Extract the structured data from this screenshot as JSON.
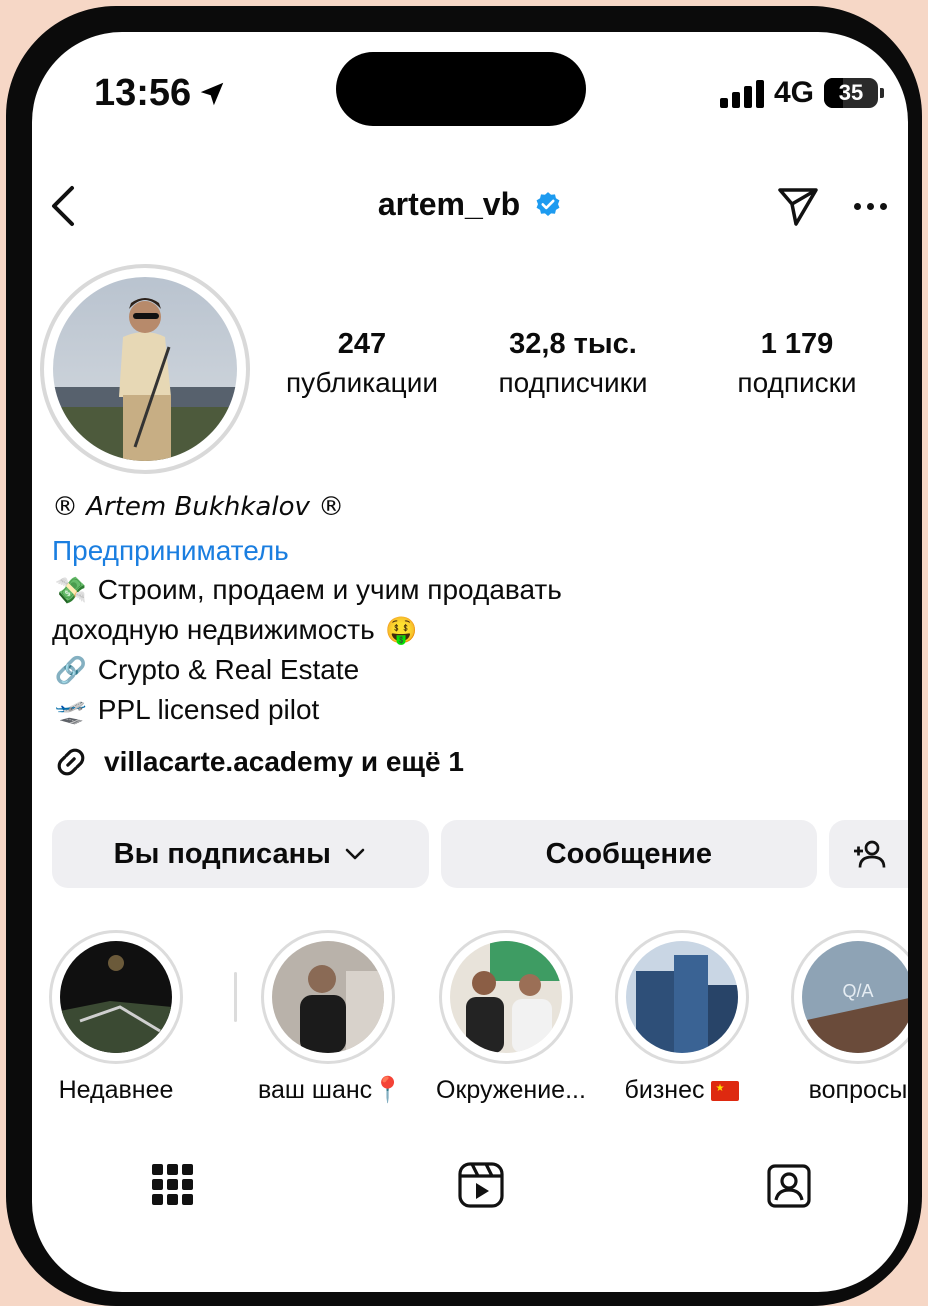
{
  "status_bar": {
    "time": "13:56",
    "network": "4G",
    "battery": "35"
  },
  "header": {
    "username": "artem_vb"
  },
  "stats": [
    {
      "number": "247",
      "label": "публикации"
    },
    {
      "number": "32,8 тыс.",
      "label": "подписчики"
    },
    {
      "number": "1 179",
      "label": "подписки"
    }
  ],
  "bio": {
    "name": "® Artem Bukhkalov ®",
    "category": "Предприниматель",
    "line1": "Строим, продаем и учим продавать",
    "line2": "доходную недвижимость",
    "line3": "Crypto & Real Estate",
    "line4": "PPL licensed pilot",
    "link": "villacarte.academy и ещё 1"
  },
  "actions": {
    "following": "Вы подписаны",
    "message": "Сообщение"
  },
  "highlights": [
    {
      "label": "Недавнее"
    },
    {
      "label": "ваш шанс"
    },
    {
      "label": "Окружение..."
    },
    {
      "label": "бизнес"
    },
    {
      "label": "вопросы"
    }
  ],
  "icons": {
    "location_arrow": "location-arrow-icon",
    "back": "chevron-left-icon",
    "verified": "verified-badge-icon",
    "send": "paper-plane-icon",
    "more": "more-dots-icon",
    "link": "link-icon",
    "add_person": "add-person-icon",
    "grid": "grid-icon",
    "reels": "reels-icon",
    "tagged": "tagged-person-icon"
  },
  "colors": {
    "link_blue": "#1a7ee0",
    "verified_blue": "#1d9bf0",
    "button_bg": "#efeff2"
  }
}
